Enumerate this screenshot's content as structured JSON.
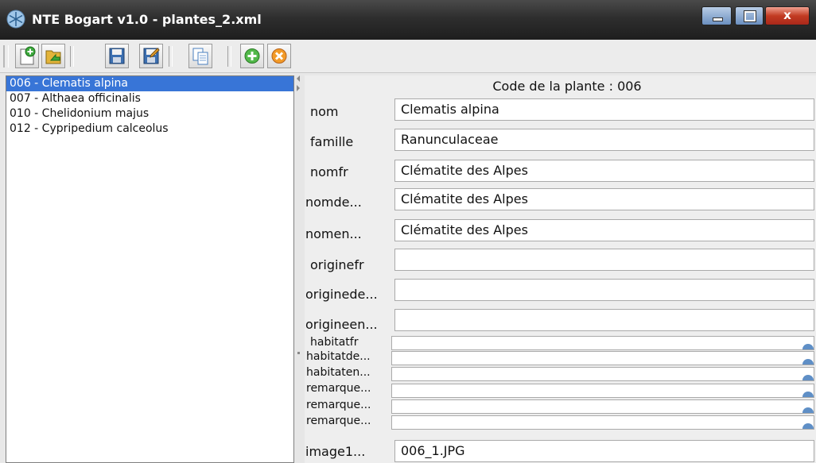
{
  "window": {
    "title": "NTE Bogart v1.0 - plantes_2.xml",
    "close_glyph": "x"
  },
  "toolbar": {
    "buttons": [
      {
        "name": "new-file-icon"
      },
      {
        "name": "open-folder-icon"
      },
      {
        "name": "save-icon"
      },
      {
        "name": "save-as-icon"
      },
      {
        "name": "copy-icon"
      },
      {
        "name": "add-green-icon"
      },
      {
        "name": "remove-orange-icon"
      }
    ]
  },
  "plant_list": {
    "items": [
      "006 - Clematis alpina",
      "007 - Althaea officinalis",
      "010 - Chelidonium majus",
      "012 - Cypripedium calceolus"
    ],
    "selected_index": 0
  },
  "form": {
    "code_label": "Code de la plante : 006",
    "fields": [
      {
        "label": "nom",
        "value": "Clematis alpina"
      },
      {
        "label": "famille",
        "value": "Ranunculaceae"
      },
      {
        "label": "nomfr",
        "value": "Clématite des Alpes"
      },
      {
        "label": "nomde...",
        "value": "Clématite des Alpes"
      },
      {
        "label": "nomen...",
        "value": "Clématite des Alpes"
      },
      {
        "label": "originefr",
        "value": ""
      },
      {
        "label": "originede...",
        "value": ""
      },
      {
        "label": "origineen...",
        "value": ""
      }
    ],
    "small_fields": [
      {
        "label": "habitatfr"
      },
      {
        "label": "habitatde..."
      },
      {
        "label": "habitaten..."
      },
      {
        "label": "remarque..."
      },
      {
        "label": "remarque..."
      },
      {
        "label": "remarque..."
      }
    ],
    "image_field": {
      "label": "image1...",
      "value": "006_1.JPG"
    }
  },
  "colors": {
    "selection": "#3875d7",
    "titlebar": "#2e2e2e"
  }
}
